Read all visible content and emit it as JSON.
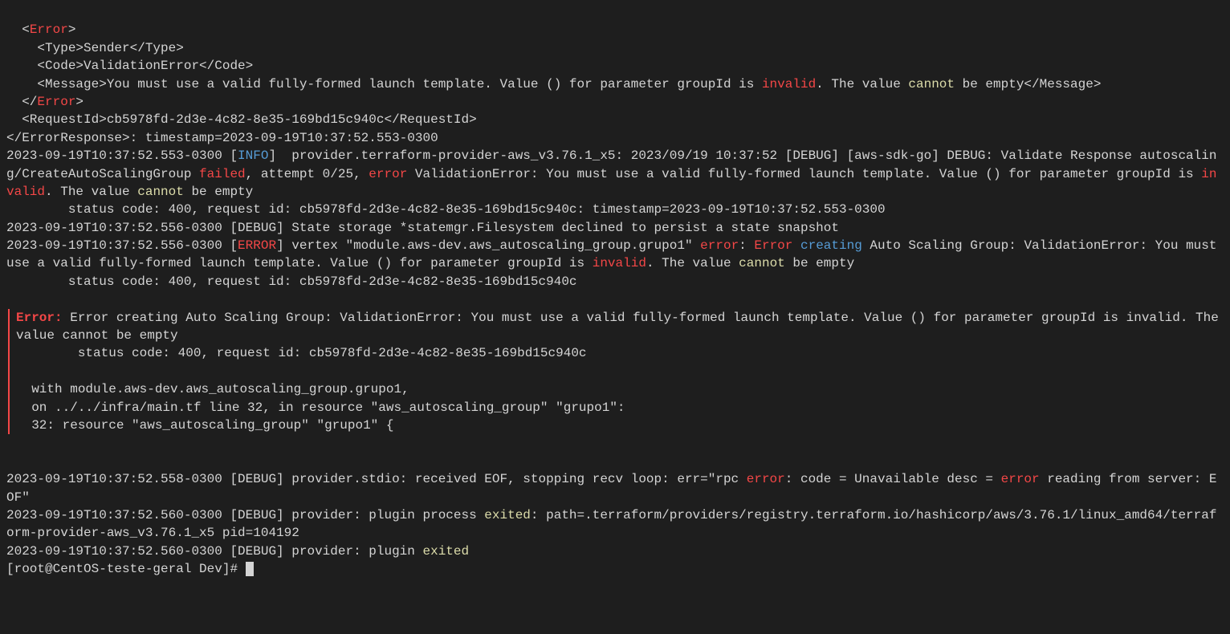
{
  "log": {
    "l01": "  <",
    "l01_err": "Error",
    "l01b": ">",
    "l02": "    <Type>Sender</Type>",
    "l03": "    <Code>ValidationError</Code>",
    "l04a": "    <Message>You must use a valid fully-formed launch template. Value () for parameter groupId is ",
    "l04_invalid": "invalid",
    "l04b": ". The value ",
    "l04_cannot": "cannot",
    "l04c": " be empty</Message>",
    "l05a": "  </",
    "l05_err": "Error",
    "l05b": ">",
    "l06": "  <RequestId>cb5978fd-2d3e-4c82-8e35-169bd15c940c</RequestId>",
    "l07": "</ErrorResponse>: timestamp=2023-09-19T10:37:52.553-0300",
    "l08a": "2023-09-19T10:37:52.553-0300 [",
    "l08_info": "INFO",
    "l08b": "]  provider.terraform-provider-aws_v3.76.1_x5: 2023/09/19 10:37:52 [DEBUG] [aws-sdk-go] DEBUG: Validate Response autoscaling/CreateAutoScalingGroup ",
    "l08_failed": "failed",
    "l08c": ", attempt 0/25, ",
    "l08_error": "error",
    "l08d": " ValidationError: You must use a valid fully-formed launch template. Value () for parameter groupId is ",
    "l08_invalid": "invalid",
    "l08e": ". The value ",
    "l08_cannot": "cannot",
    "l08f": " be empty",
    "l09": "        status code: 400, request id: cb5978fd-2d3e-4c82-8e35-169bd15c940c: timestamp=2023-09-19T10:37:52.553-0300",
    "l10": "2023-09-19T10:37:52.556-0300 [DEBUG] State storage *statemgr.Filesystem declined to persist a state snapshot",
    "l11a": "2023-09-19T10:37:52.556-0300 [",
    "l11_error": "ERROR",
    "l11b": "] vertex \"module.aws-dev.aws_autoscaling_group.grupo1\" ",
    "l11_error2": "error",
    "l11c": ": ",
    "l11_Error": "Error",
    "l11d": " ",
    "l11_creating": "creating",
    "l11e": " Auto Scaling Group: ValidationError: You must use a valid fully-formed launch template. Value () for parameter groupId is ",
    "l11_invalid": "invalid",
    "l11f": ". The value ",
    "l11_cannot": "cannot",
    "l11g": " be empty",
    "l12": "        status code: 400, request id: cb5978fd-2d3e-4c82-8e35-169bd15c940c",
    "eblock": {
      "hdr_err": "Error:",
      "hdr_rest": " Error creating Auto Scaling Group: ValidationError: You must use a valid fully-formed launch template. Value () for parameter groupId is invalid. The value cannot be empty",
      "l2": "        status code: 400, request id: cb5978fd-2d3e-4c82-8e35-169bd15c940c",
      "l3": "",
      "l4": "  with module.aws-dev.aws_autoscaling_group.grupo1,",
      "l5": "  on ../../infra/main.tf line 32, in resource \"aws_autoscaling_group\" \"grupo1\":",
      "l6": "  32: resource \"aws_autoscaling_group\" \"grupo1\" {"
    },
    "l13a": "2023-09-19T10:37:52.558-0300 [DEBUG] provider.stdio: received EOF, stopping recv loop: err=\"rpc ",
    "l13_error": "error",
    "l13b": ": code = Unavailable desc = ",
    "l13_error2": "error",
    "l13c": " reading from server: EOF\"",
    "l14a": "2023-09-19T10:37:52.560-0300 [DEBUG] provider: plugin process ",
    "l14_exited": "exited",
    "l14b": ": path=.terraform/providers/registry.terraform.io/hashicorp/aws/3.76.1/linux_amd64/terraform-provider-aws_v3.76.1_x5 pid=104192",
    "l15a": "2023-09-19T10:37:52.560-0300 [DEBUG] provider: plugin ",
    "l15_exited": "exited",
    "prompt": "[root@CentOS-teste-geral Dev]# "
  }
}
